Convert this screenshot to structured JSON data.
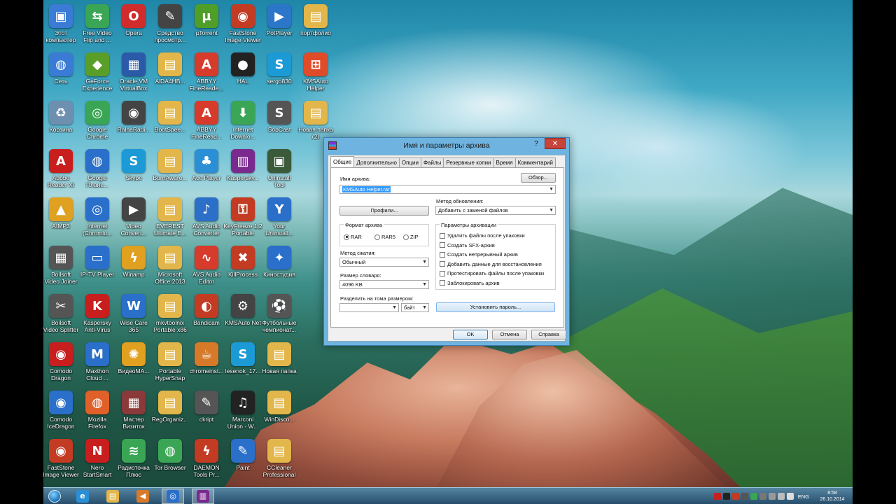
{
  "desktop_icons": [
    {
      "label": "Этот\nкомпьютер",
      "color": "#3a7bd5",
      "glyph": "▣",
      "col": 0,
      "row": 0
    },
    {
      "label": "Free Video\nFlip and ...",
      "color": "#3aa655",
      "glyph": "⇆",
      "col": 1,
      "row": 0
    },
    {
      "label": "Opera",
      "color": "#d12c2c",
      "glyph": "O",
      "col": 2,
      "row": 0
    },
    {
      "label": "Средство\nпросмотр...",
      "color": "#444444",
      "glyph": "✎",
      "col": 3,
      "row": 0
    },
    {
      "label": "µTorrent",
      "color": "#4f9e2a",
      "glyph": "µ",
      "col": 4,
      "row": 0
    },
    {
      "label": "FastStone\nImage Viewer",
      "color": "#c23b22",
      "glyph": "◉",
      "col": 5,
      "row": 0
    },
    {
      "label": "PotPlayer",
      "color": "#2b76c9",
      "glyph": "▶",
      "col": 6,
      "row": 0
    },
    {
      "label": "портфолио",
      "color": "#e2b64a",
      "glyph": "▤",
      "col": 7,
      "row": 0
    },
    {
      "label": "Сеть",
      "color": "#3a7bd5",
      "glyph": "◍",
      "col": 0,
      "row": 1
    },
    {
      "label": "GeForce\nExperience",
      "color": "#5a9e2a",
      "glyph": "◆",
      "col": 1,
      "row": 1
    },
    {
      "label": "Oracle VM\nVirtualBox",
      "color": "#2a5aa8",
      "glyph": "▦",
      "col": 2,
      "row": 1
    },
    {
      "label": "AlDA4HB...",
      "color": "#e2b64a",
      "glyph": "▤",
      "col": 3,
      "row": 1
    },
    {
      "label": "ABBYY\nFineReade...",
      "color": "#d63b2b",
      "glyph": "A",
      "col": 4,
      "row": 1
    },
    {
      "label": "HAL",
      "color": "#222222",
      "glyph": "●",
      "col": 5,
      "row": 1
    },
    {
      "label": "sergo830",
      "color": "#1b9ad6",
      "glyph": "S",
      "col": 6,
      "row": 1
    },
    {
      "label": "KMSAuto\nHelper",
      "color": "#e04b2a",
      "glyph": "⊞",
      "col": 7,
      "row": 1
    },
    {
      "label": "Корзина",
      "color": "#6d8fb0",
      "glyph": "♻",
      "col": 0,
      "row": 2
    },
    {
      "label": "Google\nChrome",
      "color": "#3aa655",
      "glyph": "◎",
      "col": 1,
      "row": 2
    },
    {
      "label": "RalnaRadi...",
      "color": "#444444",
      "glyph": "◉",
      "col": 2,
      "row": 2
    },
    {
      "label": "BootSpee...",
      "color": "#e2b64a",
      "glyph": "▤",
      "col": 3,
      "row": 2
    },
    {
      "label": "ABBYY\nFineRead...",
      "color": "#d63b2b",
      "glyph": "A",
      "col": 4,
      "row": 2
    },
    {
      "label": "Internet\nDownlo...",
      "color": "#3aa655",
      "glyph": "⬇",
      "col": 5,
      "row": 2
    },
    {
      "label": "SopCast",
      "color": "#555555",
      "glyph": "S",
      "col": 6,
      "row": 2
    },
    {
      "label": "Новая папка\n(2)",
      "color": "#e2b64a",
      "glyph": "▤",
      "col": 7,
      "row": 2
    },
    {
      "label": "Adobe\nReader XI",
      "color": "#c81e1e",
      "glyph": "A",
      "col": 0,
      "row": 3
    },
    {
      "label": "Google\nПлане...",
      "color": "#2a6fc9",
      "glyph": "◍",
      "col": 1,
      "row": 3
    },
    {
      "label": "Skype",
      "color": "#1b9ad6",
      "glyph": "S",
      "col": 2,
      "row": 3
    },
    {
      "label": "BurnAware...",
      "color": "#e2b64a",
      "glyph": "▤",
      "col": 3,
      "row": 3
    },
    {
      "label": "Ace Player",
      "color": "#2b8fd6",
      "glyph": "♣",
      "col": 4,
      "row": 3
    },
    {
      "label": "Kaspersky...",
      "color": "#7a2a8e",
      "glyph": "▥",
      "col": 5,
      "row": 3
    },
    {
      "label": "Uninstall\nTool",
      "color": "#3a5a3a",
      "glyph": "▣",
      "col": 6,
      "row": 3
    },
    {
      "label": "AIMP3",
      "color": "#e0a020",
      "glyph": "▲",
      "col": 0,
      "row": 4
    },
    {
      "label": "Internet\n(Chromiu...",
      "color": "#2a6fc9",
      "glyph": "◎",
      "col": 1,
      "row": 4
    },
    {
      "label": "Video\nConvert...",
      "color": "#444444",
      "glyph": "▶",
      "col": 2,
      "row": 4
    },
    {
      "label": "EVEREST\nUltimate E...",
      "color": "#e2b64a",
      "glyph": "▤",
      "col": 3,
      "row": 4
    },
    {
      "label": "AVS Audio\nConverter",
      "color": "#2b6fc9",
      "glyph": "♪",
      "col": 4,
      "row": 4
    },
    {
      "label": "KeyFreeze 1.2\nPortable",
      "color": "#c23b22",
      "glyph": "⚿",
      "col": 5,
      "row": 4
    },
    {
      "label": "Your\nUninstall...",
      "color": "#2a6fc9",
      "glyph": "Y",
      "col": 6,
      "row": 4
    },
    {
      "label": "Boilsoft\nVideo Joiner",
      "color": "#555555",
      "glyph": "▦",
      "col": 0,
      "row": 5
    },
    {
      "label": "IP-TV Player",
      "color": "#2a6fc9",
      "glyph": "▭",
      "col": 1,
      "row": 5
    },
    {
      "label": "Winamp",
      "color": "#e0a020",
      "glyph": "ϟ",
      "col": 2,
      "row": 5
    },
    {
      "label": "Microsoft\nOffice 2013",
      "color": "#e2b64a",
      "glyph": "▤",
      "col": 3,
      "row": 5
    },
    {
      "label": "AVS Audio\nEditor",
      "color": "#d63b2b",
      "glyph": "∿",
      "col": 4,
      "row": 5
    },
    {
      "label": "KillProcess",
      "color": "#c23b22",
      "glyph": "✖",
      "col": 5,
      "row": 5
    },
    {
      "label": "Киностудия",
      "color": "#2a6fc9",
      "glyph": "✦",
      "col": 6,
      "row": 5
    },
    {
      "label": "Boilsoft\nVideo Splitter",
      "color": "#555555",
      "glyph": "✂",
      "col": 0,
      "row": 6
    },
    {
      "label": "Kaspersky\nAnti-Virus",
      "color": "#c81e1e",
      "glyph": "K",
      "col": 1,
      "row": 6
    },
    {
      "label": "Wise Care\n365",
      "color": "#2a6fc9",
      "glyph": "W",
      "col": 2,
      "row": 6
    },
    {
      "label": "mkvtoolnix\nPortable x86",
      "color": "#e2b64a",
      "glyph": "▤",
      "col": 3,
      "row": 6
    },
    {
      "label": "Bandicam",
      "color": "#c23b22",
      "glyph": "◐",
      "col": 4,
      "row": 6
    },
    {
      "label": "KMSAuto Net",
      "color": "#444444",
      "glyph": "⚙",
      "col": 5,
      "row": 6
    },
    {
      "label": "Футбольные\nчемпионат...",
      "color": "#555555",
      "glyph": "⚽",
      "col": 6,
      "row": 6
    },
    {
      "label": "Comodo\nDragon",
      "color": "#c81e1e",
      "glyph": "◉",
      "col": 0,
      "row": 7
    },
    {
      "label": "Maxthon\nCloud ...",
      "color": "#2a6fc9",
      "glyph": "M",
      "col": 1,
      "row": 7
    },
    {
      "label": "ВидеоМА...",
      "color": "#e0a020",
      "glyph": "✺",
      "col": 2,
      "row": 7
    },
    {
      "label": "Portable\nHyperSnap",
      "color": "#e2b64a",
      "glyph": "▤",
      "col": 3,
      "row": 7
    },
    {
      "label": "chromeinst...",
      "color": "#d67a2a",
      "glyph": "☕",
      "col": 4,
      "row": 7
    },
    {
      "label": "lesenok_17...",
      "color": "#1b9ad6",
      "glyph": "S",
      "col": 5,
      "row": 7
    },
    {
      "label": "Новая папка",
      "color": "#e2b64a",
      "glyph": "▤",
      "col": 6,
      "row": 7
    },
    {
      "label": "Comodo\nIceDragon",
      "color": "#2a6fc9",
      "glyph": "◉",
      "col": 0,
      "row": 8
    },
    {
      "label": "Mozilla\nFirefox",
      "color": "#e0602a",
      "glyph": "◍",
      "col": 1,
      "row": 8
    },
    {
      "label": "Мастер\nВизиток",
      "color": "#8a3a3a",
      "glyph": "▦",
      "col": 2,
      "row": 8
    },
    {
      "label": "RegOrganiz...",
      "color": "#e2b64a",
      "glyph": "▤",
      "col": 3,
      "row": 8
    },
    {
      "label": "ckript",
      "color": "#555555",
      "glyph": "✎",
      "col": 4,
      "row": 8
    },
    {
      "label": "Marconi\nUnion - W...",
      "color": "#222222",
      "glyph": "♫",
      "col": 5,
      "row": 8
    },
    {
      "label": "WinDisco...",
      "color": "#e2b64a",
      "glyph": "▤",
      "col": 6,
      "row": 8
    },
    {
      "label": "FastStone\nImage Viewer",
      "color": "#c23b22",
      "glyph": "◉",
      "col": 0,
      "row": 9
    },
    {
      "label": "Nero\nStartSmart",
      "color": "#c81e1e",
      "glyph": "N",
      "col": 1,
      "row": 9
    },
    {
      "label": "Радиоточка\nПлюс",
      "color": "#3aa655",
      "glyph": "≋",
      "col": 2,
      "row": 9
    },
    {
      "label": "Tor Browser",
      "color": "#3aa655",
      "glyph": "◍",
      "col": 3,
      "row": 9
    },
    {
      "label": "DAEMON\nTools Pr...",
      "color": "#c23b22",
      "glyph": "ϟ",
      "col": 4,
      "row": 9
    },
    {
      "label": "Paint",
      "color": "#2a6fc9",
      "glyph": "✎",
      "col": 5,
      "row": 9
    },
    {
      "label": "CCleaner\nProfessional",
      "color": "#e2b64a",
      "glyph": "▤",
      "col": 6,
      "row": 9
    }
  ],
  "dialog": {
    "title": "Имя и параметры архива",
    "help_glyph": "?",
    "close_glyph": "✕",
    "tabs": [
      "Общие",
      "Дополнительно",
      "Опции",
      "Файлы",
      "Резервные копии",
      "Время",
      "Комментарий"
    ],
    "archive_name_label": "Имя архива:",
    "browse_button": "Обзор...",
    "archive_name_value": "KMSAuto Helper.rar",
    "update_method_label": "Метод обновления:",
    "update_method_value": "Добавить с заменой файлов",
    "profiles_button": "Профили...",
    "format_label": "Формат архива",
    "formats": [
      {
        "label": "RAR",
        "checked": true
      },
      {
        "label": "RAR5",
        "checked": false
      },
      {
        "label": "ZIP",
        "checked": false
      }
    ],
    "options_label": "Параметры архивации",
    "options": [
      "Удалить файлы после упаковки",
      "Создать SFX-архив",
      "Создать непрерывный архив",
      "Добавить данные для восстановления",
      "Протестировать файлы после упаковки",
      "Заблокировать архив"
    ],
    "compression_label": "Метод сжатия:",
    "compression_value": "Обычный",
    "dict_label": "Размер словаря:",
    "dict_value": "4096 KB",
    "split_label": "Разделить на тома размером:",
    "split_value": "",
    "split_unit": "байт",
    "set_password_button": "Установить пароль...",
    "ok_button": "OK",
    "cancel_button": "Отмена",
    "help_button": "Справка"
  },
  "taskbar": {
    "apps": [
      {
        "name": "ie-icon",
        "color": "#2a8fd6",
        "glyph": "e",
        "active": false
      },
      {
        "name": "explorer-icon",
        "color": "#e2b64a",
        "glyph": "▤",
        "active": false
      },
      {
        "name": "speaker-app-icon",
        "color": "#d67a2a",
        "glyph": "◀",
        "active": false
      },
      {
        "name": "chromium-icon",
        "color": "#2a6fc9",
        "glyph": "◎",
        "active": true
      },
      {
        "name": "winrar-icon",
        "color": "#7a2a8e",
        "glyph": "▥",
        "active": true
      }
    ],
    "tray_colors": [
      "#c81e1e",
      "#222222",
      "#c23b22",
      "#555555",
      "#3aa655",
      "#777777",
      "#999999",
      "#bbbbbb",
      "#dddddd"
    ],
    "language": "ENG",
    "time": "8:58",
    "date": "26.10.2014"
  }
}
